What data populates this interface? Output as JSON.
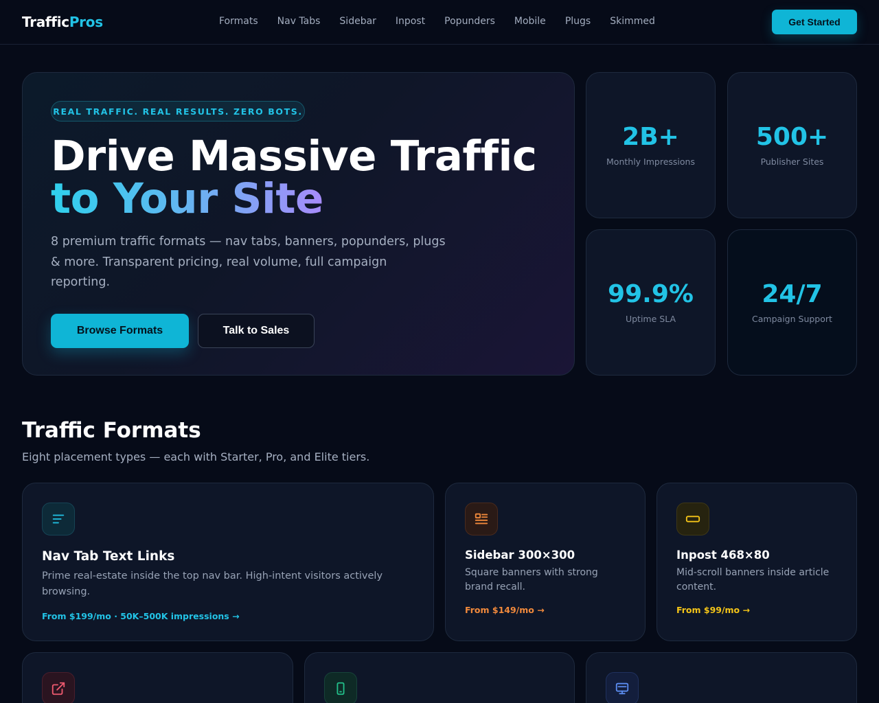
{
  "nav": {
    "logo_part1": "Traffic",
    "logo_part2": "Pros",
    "links": [
      "Formats",
      "Nav Tabs",
      "Sidebar",
      "Inpost",
      "Popunders",
      "Mobile",
      "Plugs",
      "Skimmed"
    ],
    "cta": "Get Started"
  },
  "hero": {
    "badge": "REAL TRAFFIC. REAL RESULTS. ZERO BOTS.",
    "title_line1": "Drive Massive Traffic",
    "title_line2": "to Your Site",
    "description": "8 premium traffic formats — nav tabs, banners, popunders, plugs & more. Transparent pricing, real volume, full campaign reporting.",
    "primary_button": "Browse Formats",
    "secondary_button": "Talk to Sales"
  },
  "stats": [
    {
      "value": "2B+",
      "label": "Monthly Impressions"
    },
    {
      "value": "500+",
      "label": "Publisher Sites"
    },
    {
      "value": "99.9%",
      "label": "Uptime SLA"
    },
    {
      "value": "24/7",
      "label": "Campaign Support"
    }
  ],
  "formats": {
    "title": "Traffic Formats",
    "subtitle": "Eight placement types — each with Starter, Pro, and Elite tiers.",
    "cards": [
      {
        "title": "Nav Tab Text Links",
        "description": "Prime real-estate inside the top nav bar. High-intent visitors actively browsing.",
        "link": "From $199/mo · 50K–500K impressions →",
        "icon": "text-lines-icon",
        "accent": "#22c3e6"
      },
      {
        "title": "Sidebar 300×300",
        "description": "Square banners with strong brand recall.",
        "link": "From $149/mo →",
        "icon": "sidebar-layout-icon",
        "accent": "#f28a3c"
      },
      {
        "title": "Inpost 468×80",
        "description": "Mid-scroll banners inside article content.",
        "link": "From $99/mo →",
        "icon": "banner-rect-icon",
        "accent": "#f5c518"
      },
      {
        "icon": "external-link-icon",
        "accent": "#ef5a6f"
      },
      {
        "icon": "mobile-phone-icon",
        "accent": "#22c08a"
      },
      {
        "icon": "monitor-icon",
        "accent": "#5b8cf0"
      }
    ]
  },
  "colors": {
    "background": "#060b18",
    "accent": "#0fb5d6",
    "card": "#0e1628"
  }
}
